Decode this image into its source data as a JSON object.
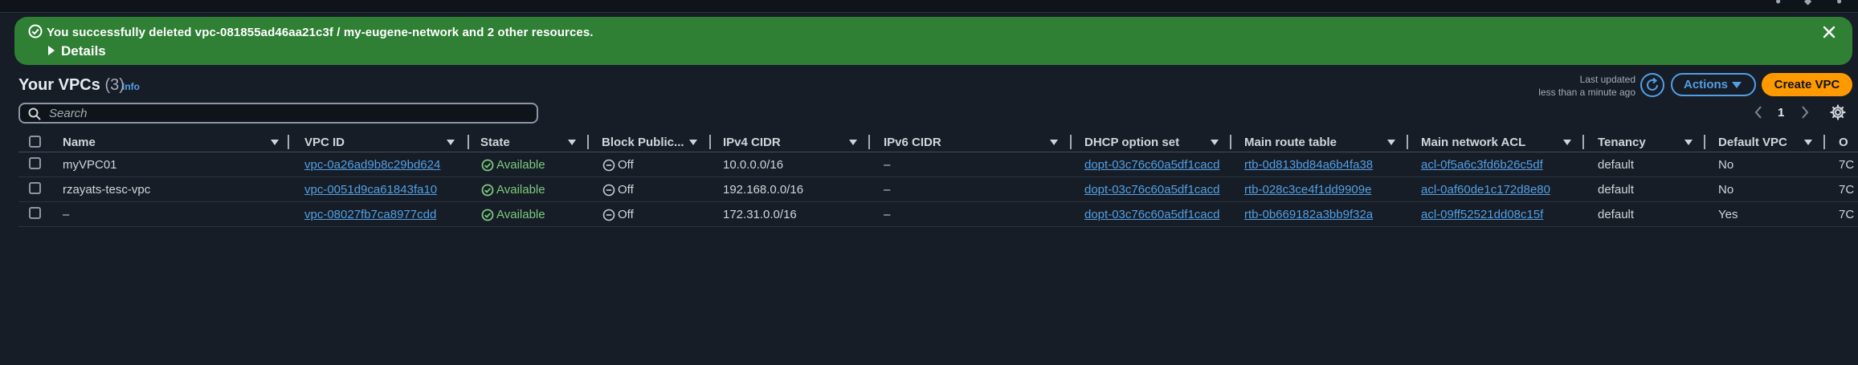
{
  "banner": {
    "message": "You successfully deleted vpc-081855ad46aa21c3f / my-eugene-network and 2 other resources.",
    "details_label": "Details",
    "color": "#2f7f35"
  },
  "header": {
    "title": "Your VPCs",
    "count": "(3)",
    "info_label": "Info",
    "last_updated_line1": "Last updated",
    "last_updated_line2": "less than a minute ago",
    "actions_label": "Actions",
    "create_label": "Create VPC"
  },
  "search": {
    "placeholder": "Search"
  },
  "pagination": {
    "current_page": "1"
  },
  "table": {
    "columns": [
      "Name",
      "VPC ID",
      "State",
      "Block Public...",
      "IPv4 CIDR",
      "IPv6 CIDR",
      "DHCP option set",
      "Main route table",
      "Main network ACL",
      "Tenancy",
      "Default VPC",
      "O"
    ],
    "rows": [
      {
        "name": "myVPC01",
        "vpc_id": "vpc-0a26ad9b8c29bd624",
        "state": "Available",
        "block_public": "Off",
        "ipv4": "10.0.0.0/16",
        "ipv6": "–",
        "dhcp": "dopt-03c76c60a5df1cacd",
        "route_table": "rtb-0d813bd84a6b4fa38",
        "acl": "acl-0f5a6c3fd6b26c5df",
        "tenancy": "default",
        "default_vpc": "No",
        "owner": "7C"
      },
      {
        "name": "rzayats-tesc-vpc",
        "vpc_id": "vpc-0051d9ca61843fa10",
        "state": "Available",
        "block_public": "Off",
        "ipv4": "192.168.0.0/16",
        "ipv6": "–",
        "dhcp": "dopt-03c76c60a5df1cacd",
        "route_table": "rtb-028c3ce4f1dd9909e",
        "acl": "acl-0af60de1c172d8e80",
        "tenancy": "default",
        "default_vpc": "No",
        "owner": "7C"
      },
      {
        "name": "–",
        "vpc_id": "vpc-08027fb7ca8977cdd",
        "state": "Available",
        "block_public": "Off",
        "ipv4": "172.31.0.0/16",
        "ipv6": "–",
        "dhcp": "dopt-03c76c60a5df1cacd",
        "route_table": "rtb-0b669182a3bb9f32a",
        "acl": "acl-09ff52521dd08c15f",
        "tenancy": "default",
        "default_vpc": "Yes",
        "owner": "7C"
      }
    ]
  },
  "colors": {
    "background": "#161d26",
    "link": "#539fe5",
    "primary_button": "#ff9900",
    "success": "#7bcb7f"
  }
}
